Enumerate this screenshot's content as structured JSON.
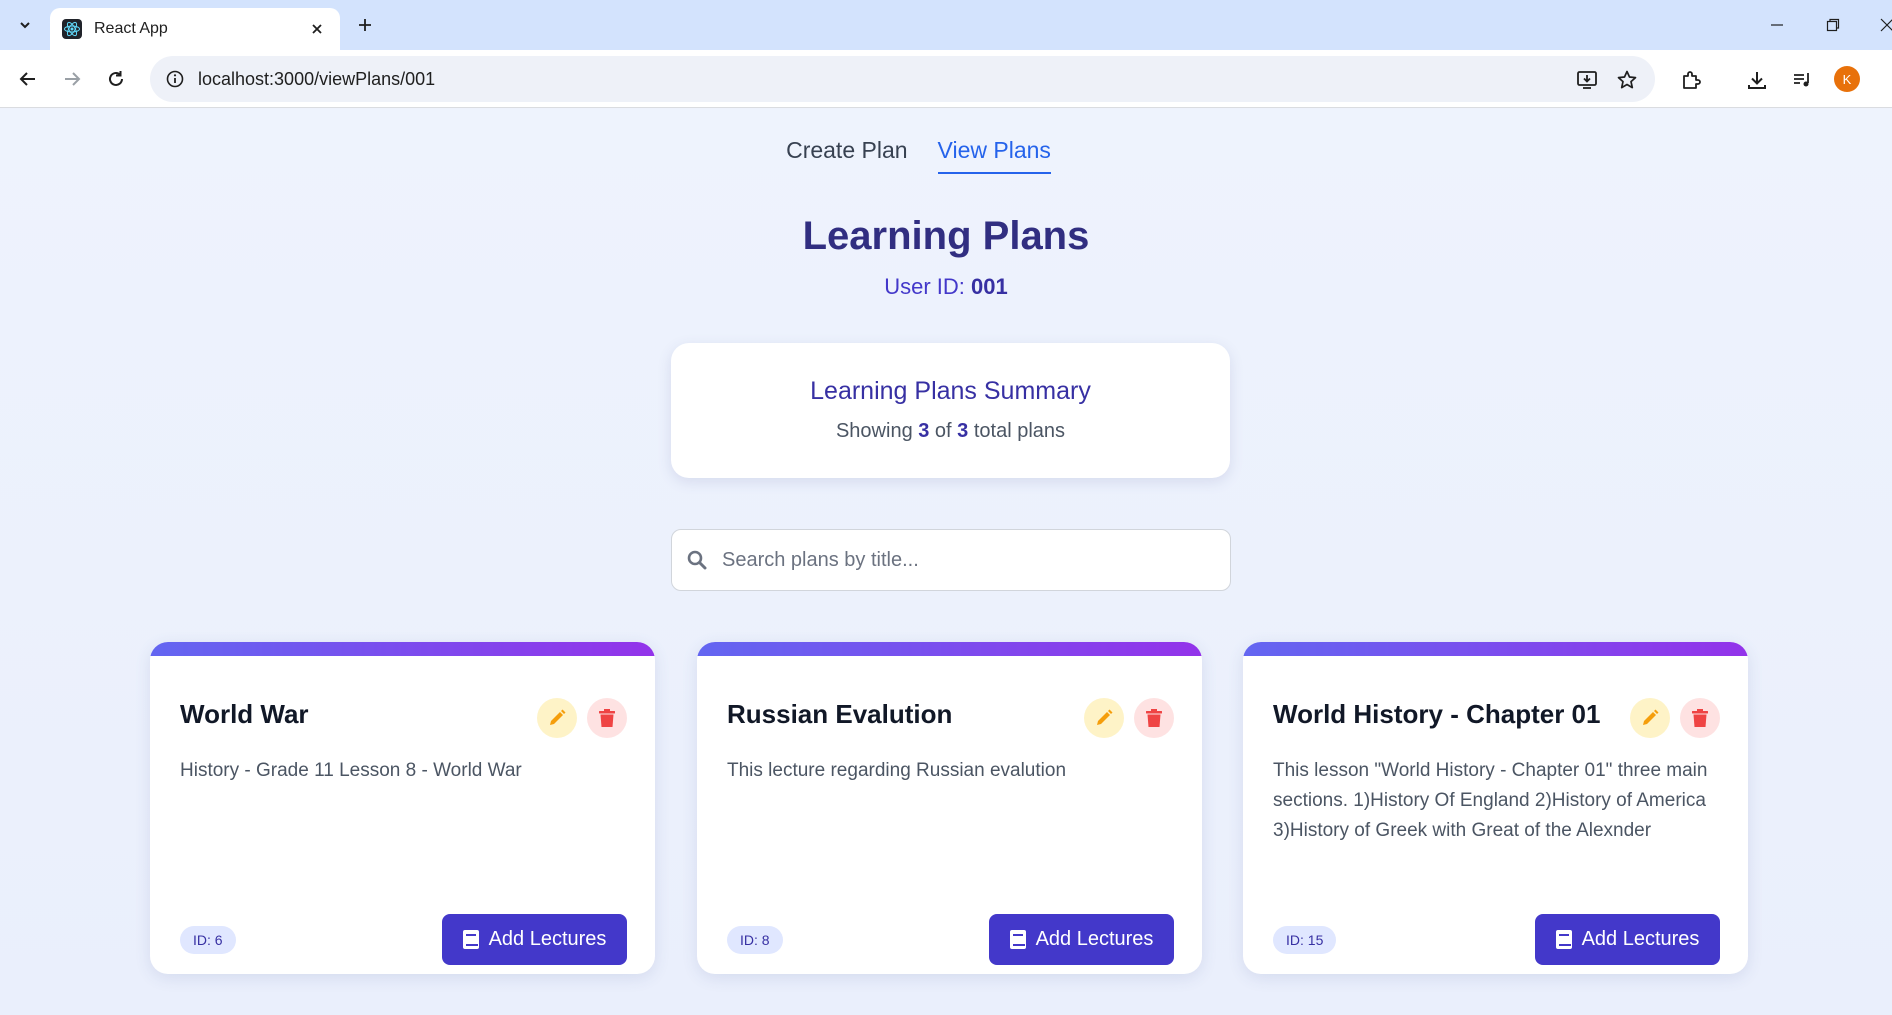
{
  "browser": {
    "tab_title": "React App",
    "url": "localhost:3000/viewPlans/001",
    "profile_initial": "K"
  },
  "nav": {
    "links": [
      {
        "label": "Create Plan"
      },
      {
        "label": "View Plans"
      }
    ],
    "active": "View Plans"
  },
  "header": {
    "title": "Learning Plans",
    "user_label": "User ID: ",
    "user_id": "001"
  },
  "summary": {
    "title": "Learning Plans Summary",
    "prefix": "Showing ",
    "shown": "3",
    "middle": " of ",
    "total": "3",
    "suffix": " total plans"
  },
  "search": {
    "placeholder": "Search plans by title..."
  },
  "plans": [
    {
      "title": "World War",
      "description": "History - Grade 11 Lesson 8 - World War",
      "id_badge": "ID: 6",
      "button_label": "Add Lectures"
    },
    {
      "title": "Russian Evalution",
      "description": "This lecture regarding Russian evalution",
      "id_badge": "ID: 8",
      "button_label": "Add Lectures"
    },
    {
      "title": "World History - Chapter 01",
      "description": "This lesson \"World History - Chapter 01\" three main sections. 1)History Of England 2)History of America 3)History of Greek with Great of the Alexnder",
      "id_badge": "ID: 15",
      "button_label": "Add Lectures"
    }
  ],
  "colors": {
    "accent": "#4338ca",
    "active_link": "#2563eb",
    "title": "#312e81",
    "card_bar_start": "#6366f1",
    "card_bar_end": "#9333ea",
    "edit_icon": "#f59e0b",
    "delete_icon": "#ef4444"
  }
}
